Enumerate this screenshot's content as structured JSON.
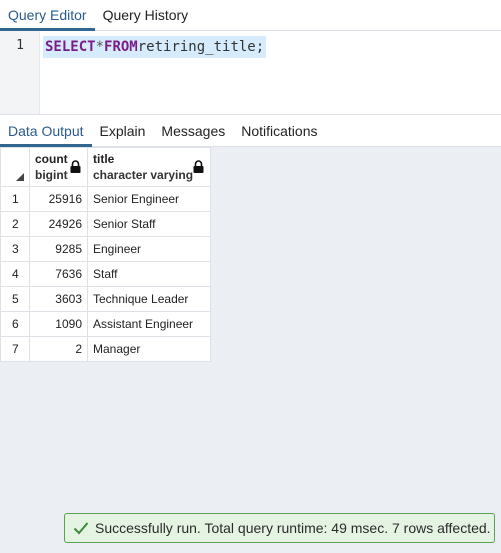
{
  "top_tabs": [
    {
      "label": "Query Editor",
      "active": true
    },
    {
      "label": "Query History",
      "active": false
    }
  ],
  "editor": {
    "line_number": "1",
    "tokens": {
      "kw1": "SELECT",
      "op": "*",
      "kw2": "FROM",
      "ident": "retiring_title",
      "end": ";"
    }
  },
  "output_tabs": [
    {
      "label": "Data Output",
      "active": true
    },
    {
      "label": "Explain",
      "active": false
    },
    {
      "label": "Messages",
      "active": false
    },
    {
      "label": "Notifications",
      "active": false
    }
  ],
  "grid": {
    "columns": [
      {
        "name": "count",
        "type": "bigint"
      },
      {
        "name": "title",
        "type": "character varying"
      }
    ],
    "rows": [
      {
        "n": "1",
        "count": "25916",
        "title": "Senior Engineer"
      },
      {
        "n": "2",
        "count": "24926",
        "title": "Senior Staff"
      },
      {
        "n": "3",
        "count": "9285",
        "title": "Engineer"
      },
      {
        "n": "4",
        "count": "7636",
        "title": "Staff"
      },
      {
        "n": "5",
        "count": "3603",
        "title": "Technique Leader"
      },
      {
        "n": "6",
        "count": "1090",
        "title": "Assistant Engineer"
      },
      {
        "n": "7",
        "count": "2",
        "title": "Manager"
      }
    ]
  },
  "status": {
    "message": "Successfully run. Total query runtime: 49 msec. 7 rows affected.",
    "icon": "check-icon"
  },
  "colors": {
    "accent": "#326690",
    "keyword": "#7a1e8c",
    "success_border": "#5aa155",
    "success_bg": "#e5f3e3"
  }
}
